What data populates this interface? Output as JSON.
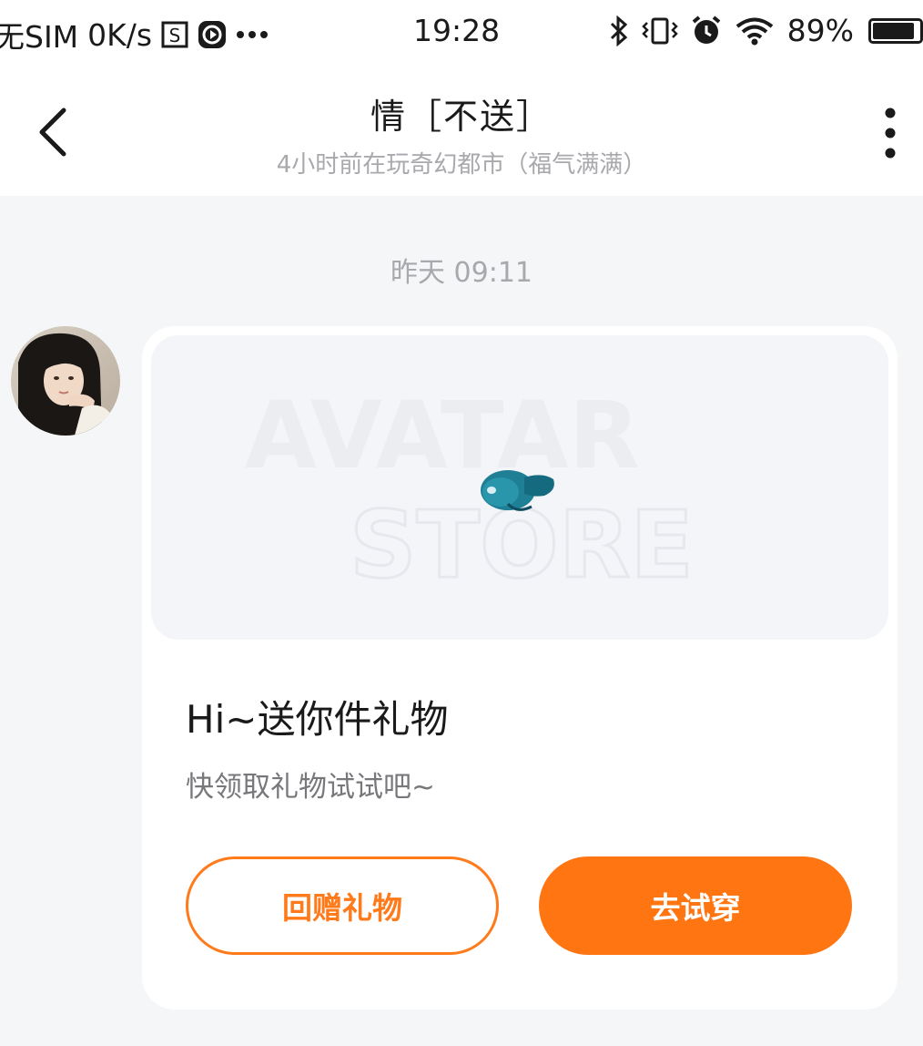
{
  "status_bar": {
    "carrier": "无SIM",
    "network_speed": "0K/s",
    "time": "19:28",
    "battery_percent": "89%",
    "battery_level": 0.89,
    "icons": [
      "sim-storage-icon",
      "media-play-icon",
      "more-dots-icon",
      "bluetooth-icon",
      "vibrate-icon",
      "alarm-icon",
      "wifi-icon",
      "battery-icon"
    ]
  },
  "header": {
    "title": "情［不送］",
    "subtitle": "4小时前在玩奇幻都市（福气满满）"
  },
  "chat": {
    "timestamp": "昨天 09:11"
  },
  "gift_card": {
    "watermark_line1": "AVATAR",
    "watermark_line2": "STORE",
    "title": "Hi~送你件礼物",
    "description": "快领取礼物试试吧~",
    "return_gift_label": "回赠礼物",
    "try_on_label": "去试穿"
  },
  "colors": {
    "accent": "#ff7512",
    "background": "#f5f6f8",
    "subtext": "#a8a8ad"
  }
}
